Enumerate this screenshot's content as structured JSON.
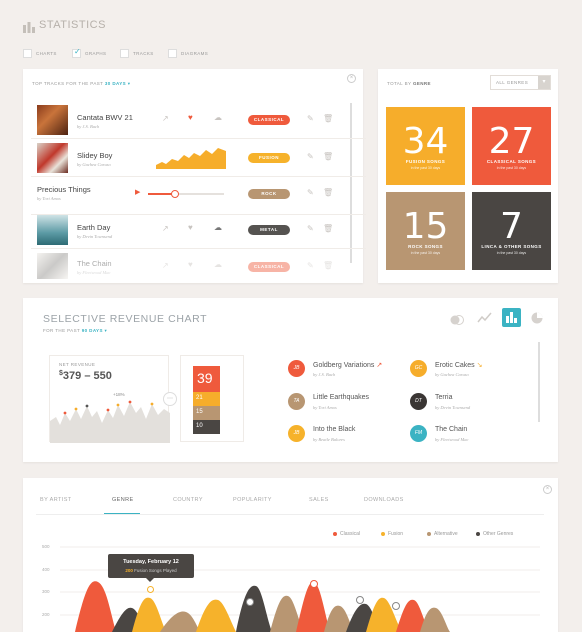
{
  "header": {
    "title": "STATISTICS"
  },
  "view_options": [
    {
      "label": "CHARTS",
      "checked": false
    },
    {
      "label": "GRAPHS",
      "checked": true
    },
    {
      "label": "TRACKS",
      "checked": false
    },
    {
      "label": "DIAGRAMS",
      "checked": false
    }
  ],
  "top_tracks": {
    "heading": "TOP TRACKS FOR THE PAST",
    "period": "30 DAYS",
    "tracks": [
      {
        "title": "Cantata BWV 21",
        "artist": "by J.S. Bach",
        "genre": "CLASSICAL",
        "genre_color": "#ef5a3c"
      },
      {
        "title": "Slidey Boy",
        "artist": "by Gachea Caruso",
        "genre": "FUSION",
        "genre_color": "#f6b22b"
      },
      {
        "title": "Precious Things",
        "artist": "by Tori Amos",
        "genre": "ROCK",
        "genre_color": "#b89672"
      },
      {
        "title": "Earth Day",
        "artist": "by Devin Townsend",
        "genre": "METAL",
        "genre_color": "#555350"
      },
      {
        "title": "The Chain",
        "artist": "by Fleetwood Mac",
        "genre": "CLASSICAL",
        "genre_color": "#ef5a3c"
      }
    ]
  },
  "genre_totals": {
    "heading": "TOTAL BY",
    "heading_strong": "GENRE",
    "select_value": "ALL GENRES",
    "tiles": [
      {
        "value": "34",
        "label": "FUSION SONGS",
        "sub": "in the past 30 days",
        "color": "#f6ad2b"
      },
      {
        "value": "27",
        "label": "CLASSICAL SONGS",
        "sub": "in the past 30 days",
        "color": "#ef5a3c"
      },
      {
        "value": "15",
        "label": "ROCK SONGS",
        "sub": "in the past 30 days",
        "color": "#b89672"
      },
      {
        "value": "7",
        "label": "LINCA & OTHER SONGS",
        "sub": "in the past 30 days",
        "color": "#4a4643"
      }
    ]
  },
  "revenue": {
    "title": "SELECTIVE REVENUE CHART",
    "subtitle": "FOR THE PAST",
    "subtitle_period": "90 DAYS",
    "net_label": "NET REVENUE",
    "net_currency": "$",
    "net_value": "379 – 550",
    "badge": "+18%",
    "stack_values": [
      "39",
      "21",
      "15",
      "10"
    ],
    "songs": [
      {
        "initials": "JB",
        "name": "Goldberg Variations",
        "artist": "by J.S. Bach",
        "color": "#ef5a3c",
        "trend": "↗"
      },
      {
        "initials": "GC",
        "name": "Erotic Cakes",
        "artist": "by Gachea Caruso",
        "color": "#f6ad2b",
        "trend": "↘"
      },
      {
        "initials": "TA",
        "name": "Little Earthquakes",
        "artist": "by Tori Amos",
        "color": "#b89672",
        "trend": ""
      },
      {
        "initials": "DT",
        "name": "Terria",
        "artist": "by Devin Townsend",
        "color": "#3a3634",
        "trend": ""
      },
      {
        "initials": "JB",
        "name": "Into the Black",
        "artist": "by Beatle Balores",
        "color": "#f6b22b",
        "trend": ""
      },
      {
        "initials": "FM",
        "name": "The Chain",
        "artist": "by Fleetwood Mac",
        "color": "#3bb3c3",
        "trend": ""
      }
    ]
  },
  "tabs": [
    "BY ARTIST",
    "GENRE",
    "COUNTRY",
    "POPULARITY",
    "SALES",
    "DOWNLOADS"
  ],
  "active_tab": "GENRE",
  "chart_data": {
    "type": "area",
    "title": "",
    "legend": [
      {
        "name": "Classical",
        "color": "#ef5a3c"
      },
      {
        "name": "Fusion",
        "color": "#f6b22b"
      },
      {
        "name": "Alternative",
        "color": "#b89672"
      },
      {
        "name": "Other Genres",
        "color": "#4a4643"
      }
    ],
    "y_ticks": [
      "500",
      "400",
      "300",
      "200"
    ],
    "tooltip_date": "Tuesday, February 12",
    "tooltip_count": "200",
    "tooltip_text": "Fusion Songs Played"
  }
}
